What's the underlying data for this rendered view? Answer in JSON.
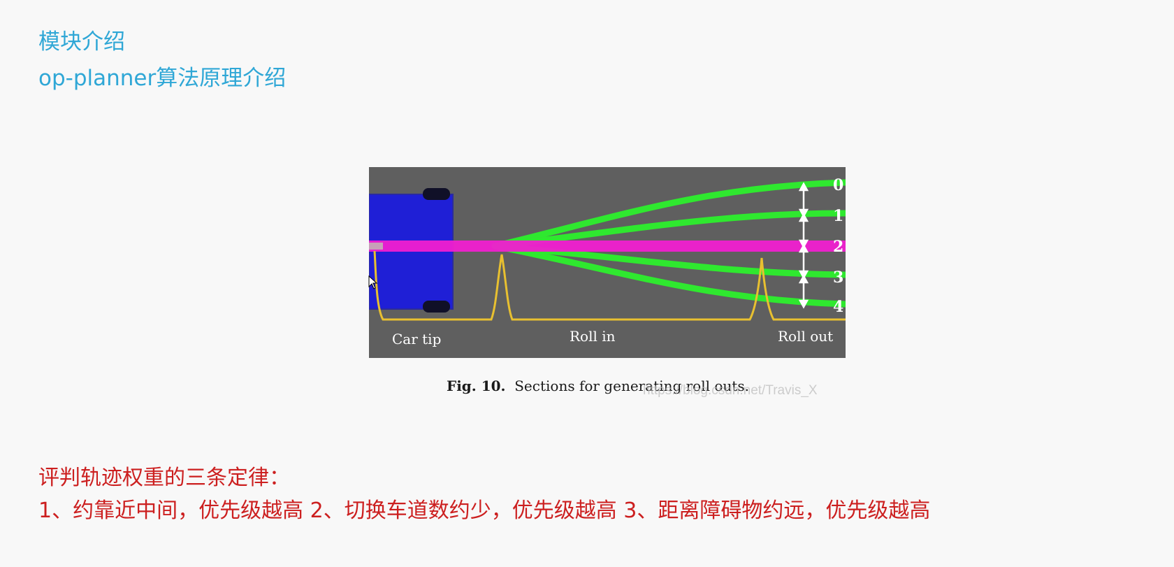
{
  "header": {
    "title_line1": "模块介绍",
    "title_line2": "op-planner算法原理介绍"
  },
  "figure": {
    "section_labels": {
      "car_tip": "Car tip",
      "roll_in": "Roll in",
      "roll_out": "Roll out"
    },
    "rollout_numbers": [
      "0",
      "1",
      "2",
      "3",
      "4"
    ],
    "caption_num": "Fig. 10.",
    "caption_text": "Sections for generating roll outs.",
    "watermark": "https://blog.csdn.net/Travis_X",
    "colors": {
      "background": "#5f5f5f",
      "car": "#1f1fd6",
      "rollout_path": "#2fe82f",
      "center_path": "#f01fd0",
      "section_bracket": "#e8c030",
      "arrow": "#ffffff"
    },
    "icons": [
      "car-icon",
      "double-arrow-icon"
    ]
  },
  "rules": {
    "heading": "评判轨迹权重的三条定律：",
    "text": "1、约靠近中间，优先级越高  2、切换车道数约少，优先级越高 3、距离障碍物约远，优先级越高"
  }
}
